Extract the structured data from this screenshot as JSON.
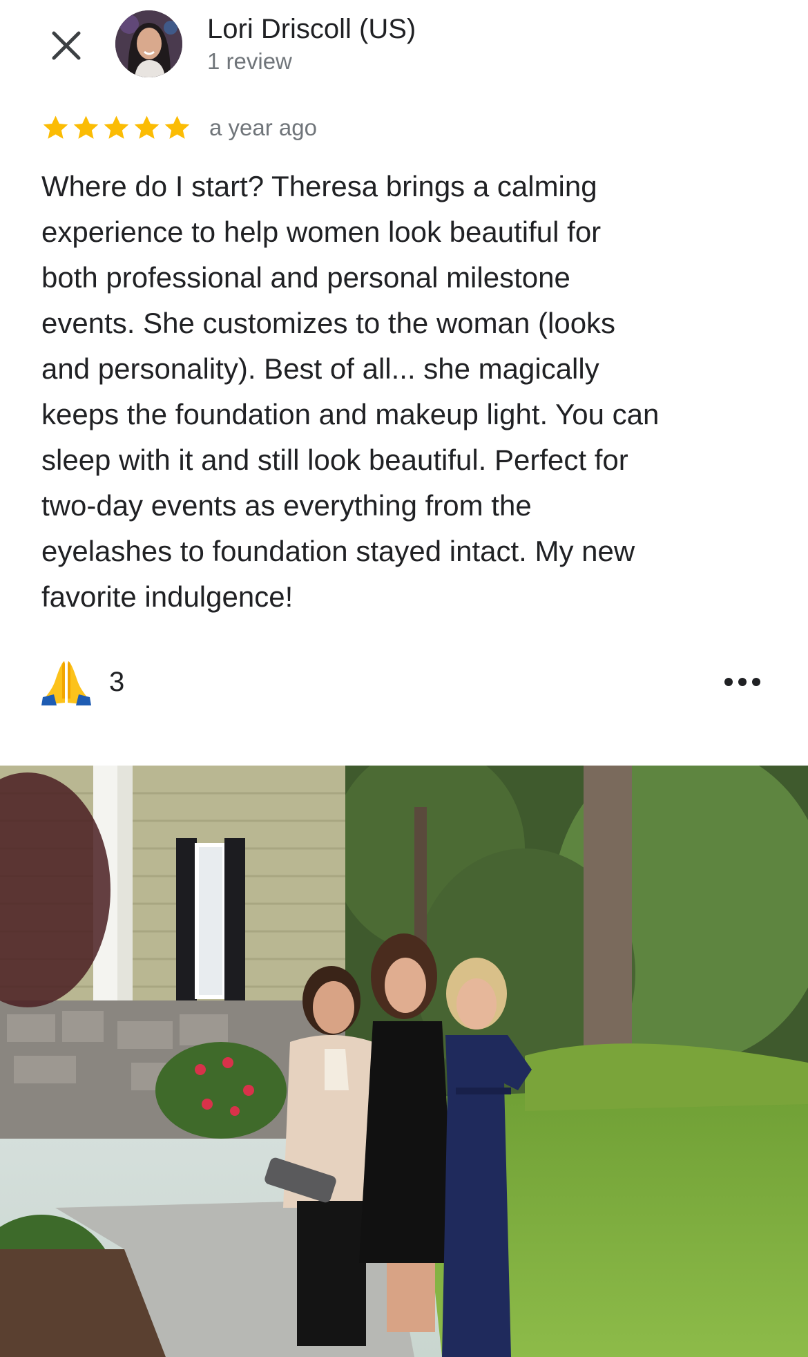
{
  "reviewer": {
    "name": "Lori Driscoll (US)",
    "meta": "1 review"
  },
  "review": {
    "rating": 5,
    "rating_max": 5,
    "time": "a year ago",
    "text": "Where do I start? Theresa brings a calming\nexperience to help women look beautiful for\nboth professional and personal milestone\nevents. She customizes to the woman (looks\nand personality). Best of all... she magically\nkeeps the foundation and makeup light. You can\nsleep with it and still look beautiful. Perfect for\ntwo-day events as everything from the\neyelashes to foundation stayed intact. My new\nfavorite indulgence!"
  },
  "reaction": {
    "icon": "folded-hands-icon",
    "count": "3"
  },
  "icons": {
    "close": "close-icon",
    "more": "more-horizontal-icon",
    "star": "star-icon"
  },
  "colors": {
    "star": "#fbbc04",
    "text_primary": "#202124",
    "text_secondary": "#70757a"
  }
}
